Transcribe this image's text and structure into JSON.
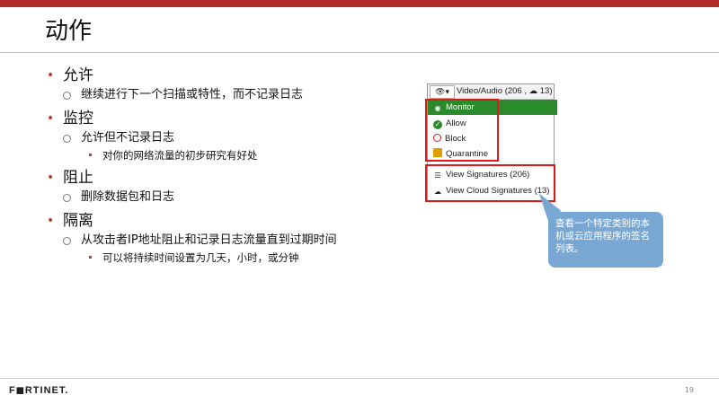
{
  "slide": {
    "title": "动作",
    "bullets": [
      {
        "label": "允许",
        "sub": [
          {
            "text": "继续进行下一个扫描或特性，而不记录日志"
          }
        ]
      },
      {
        "label": "监控",
        "sub": [
          {
            "text": "允许但不记录日志",
            "sub": [
              {
                "text": "对你的网络流量的初步研究有好处"
              }
            ]
          }
        ]
      },
      {
        "label": "阻止",
        "sub": [
          {
            "text": "删除数据包和日志"
          }
        ]
      },
      {
        "label": "隔离",
        "sub": [
          {
            "text": "从攻击者IP地址阻止和记录日志流量直到过期时间",
            "sub": [
              {
                "text": "可以将持续时间设置为几天，小时，或分钟"
              }
            ]
          }
        ]
      }
    ]
  },
  "ui_panel": {
    "header_label": "Video/Audio  (206 ,  ☁ 13)",
    "menu": {
      "monitor": "Monitor",
      "allow": "Allow",
      "block": "Block",
      "quarantine": "Quarantine",
      "view_signatures": "View Signatures (206)",
      "view_cloud_signatures": "View Cloud Signatures (13)"
    },
    "colors": {
      "selected": "#2b8a2b",
      "highlight": "#e01818"
    }
  },
  "callout": {
    "text": "查看一个特定类别的本机或云应用程序的签名列表。"
  },
  "footer": {
    "logo": "F◼RTINET.",
    "page": "19"
  }
}
